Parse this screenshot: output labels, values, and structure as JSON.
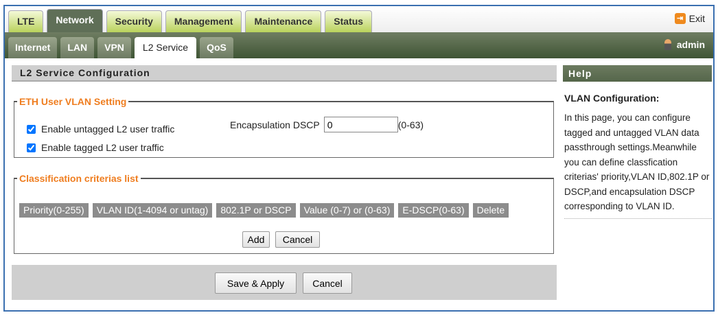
{
  "header": {
    "main_tabs": [
      "LTE",
      "Network",
      "Security",
      "Management",
      "Maintenance",
      "Status"
    ],
    "active_main_tab": "Network",
    "exit_label": "Exit",
    "sub_tabs": [
      "Internet",
      "LAN",
      "VPN",
      "L2 Service",
      "QoS"
    ],
    "active_sub_tab": "L2 Service",
    "user": "admin"
  },
  "main": {
    "title": "L2 Service Configuration",
    "eth": {
      "legend": "ETH User VLAN Setting",
      "untagged_label": "Enable untagged L2 user traffic",
      "untagged_checked": true,
      "tagged_label": "Enable tagged L2 user traffic",
      "tagged_checked": true,
      "dscp_label": "Encapsulation DSCP",
      "dscp_value": "0",
      "dscp_range": "(0-63)"
    },
    "criteria": {
      "legend": "Classification criterias list",
      "columns": [
        "Priority(0-255)",
        "VLAN ID(1-4094 or untag)",
        "802.1P or DSCP",
        "Value (0-7) or (0-63)",
        "E-DSCP(0-63)",
        "Delete"
      ],
      "add_label": "Add",
      "cancel_label": "Cancel"
    },
    "save_label": "Save & Apply",
    "cancel_label": "Cancel"
  },
  "help": {
    "title": "Help",
    "heading": "VLAN Configuration:",
    "text": "In this page, you can configure tagged and untagged VLAN data passthrough settings.Meanwhile you can define classfication criterias' priority,VLAN ID,802.1P or DSCP,and encapsulation DSCP corresponding to VLAN ID."
  }
}
